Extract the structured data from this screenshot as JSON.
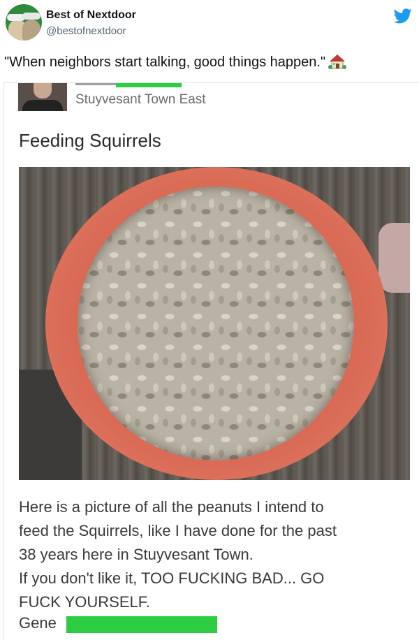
{
  "tweet": {
    "display_name": "Best of Nextdoor",
    "handle": "@bestofnextdoor",
    "text": "\"When neighbors start talking, good things happen.\"",
    "emoji_icon": "house-with-garden-icon"
  },
  "post": {
    "neighborhood": "Stuyvesant Town East",
    "title": "Feeding Squirrels",
    "body_lines": [
      "Here is a picture of all the peanuts I intend to",
      "feed the Squirrels, like I have done for the past",
      "38 years here in Stuyvesant Town.",
      "If you don't like it, TOO FUCKING BAD... GO",
      "FUCK YOURSELF."
    ],
    "signature": "Gene"
  },
  "colors": {
    "twitter_blue": "#1d9bf0",
    "redaction_green": "#2ecc40",
    "bowl_red": "#d96a55"
  }
}
